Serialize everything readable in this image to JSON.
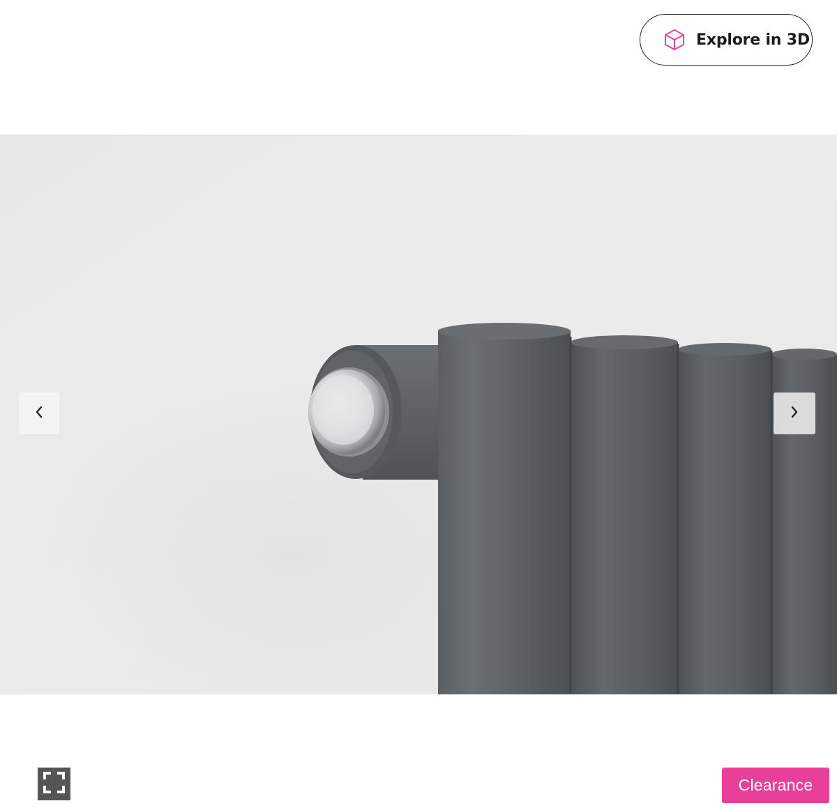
{
  "explore_button": {
    "label": "Explore in 3D",
    "icon": "cube-icon",
    "icon_color": "#e8409a"
  },
  "gallery": {
    "image_subject": "",
    "prev_icon": "chevron-left-icon",
    "next_icon": "chevron-right-icon"
  },
  "controls": {
    "fullscreen_icon": "fullscreen-icon"
  },
  "badge": {
    "label": "Clearance",
    "color": "#e8409a"
  }
}
